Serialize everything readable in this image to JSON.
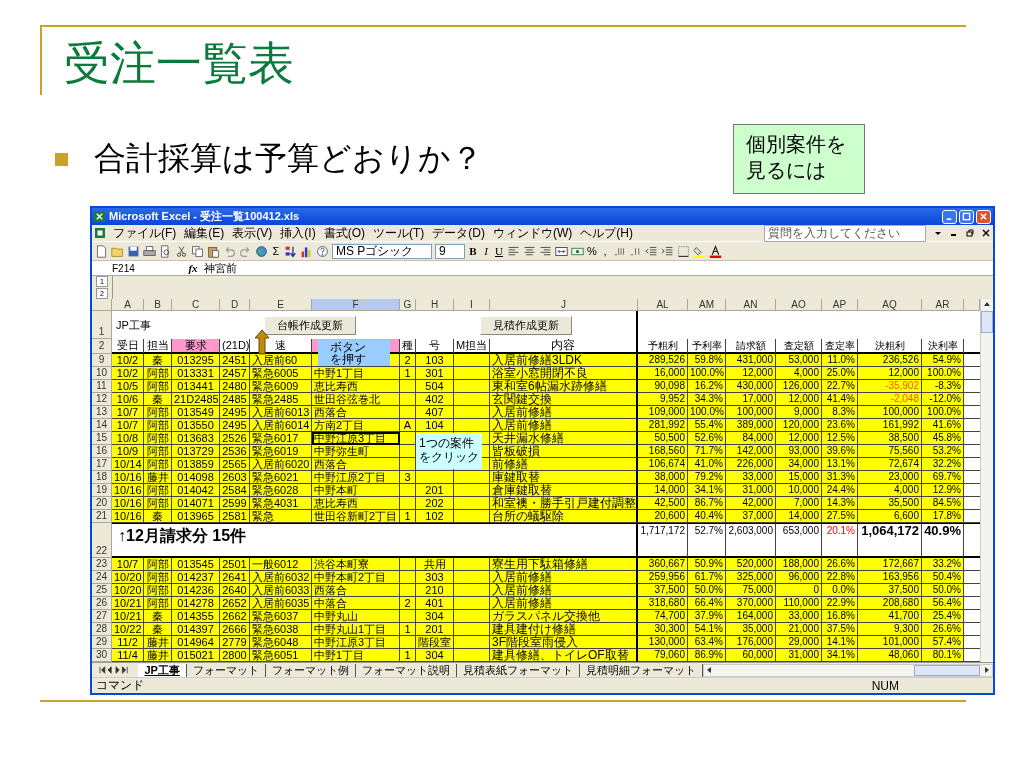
{
  "slide": {
    "title": "受注一覧表",
    "bullet": "合計採算は予算どおりか？",
    "note": "個別案件を見るには"
  },
  "window": {
    "title": "Microsoft Excel - 受注一覧100412.xls"
  },
  "menu": [
    "ファイル(F)",
    "編集(E)",
    "表示(V)",
    "挿入(I)",
    "書式(O)",
    "ツール(T)",
    "データ(D)",
    "ウィンドウ(W)",
    "ヘルプ(H)"
  ],
  "help_box": {
    "placeholder": "質問を入力してください"
  },
  "toolbar": {
    "sum": "Σ",
    "font": "MS Pゴシック",
    "size": "9",
    "format_buttons": [
      "B",
      "I",
      "U"
    ],
    "number_buttons": [
      "%",
      ","
    ]
  },
  "formula_bar": {
    "name_box": "F214",
    "fx": "fx",
    "value": "神宮前"
  },
  "outline_levels": [
    "1",
    "2"
  ],
  "columns": [
    {
      "label": "A",
      "selected": false
    },
    {
      "label": "B",
      "selected": false
    },
    {
      "label": "C",
      "selected": false
    },
    {
      "label": "D",
      "selected": false
    },
    {
      "label": "E",
      "selected": false
    },
    {
      "label": "F",
      "selected": true
    },
    {
      "label": "G",
      "selected": false
    },
    {
      "label": "H",
      "selected": false
    },
    {
      "label": "I",
      "selected": false
    },
    {
      "label": "J",
      "selected": false
    },
    {
      "label": "AL",
      "selected": false
    },
    {
      "label": "AM",
      "selected": false
    },
    {
      "label": "AN",
      "selected": false
    },
    {
      "label": "AO",
      "selected": false
    },
    {
      "label": "AP",
      "selected": false
    },
    {
      "label": "AQ",
      "selected": false
    },
    {
      "label": "AR",
      "selected": false
    }
  ],
  "row1": {
    "row": "1",
    "label": "JP工事",
    "buttons": [
      "台帳作成更新",
      "見積作成更新"
    ]
  },
  "header": {
    "row": "2",
    "cells": [
      {
        "text": "受日",
        "highlighted": false
      },
      {
        "text": "担当",
        "highlighted": false
      },
      {
        "text": "要求",
        "highlighted": true
      },
      {
        "text": "(21D)",
        "highlighted": false
      },
      {
        "text": "速",
        "highlighted": false
      },
      {
        "text": null,
        "highlighted": true
      },
      {
        "text": "種",
        "highlighted": false
      },
      {
        "text": "号",
        "highlighted": false
      },
      {
        "text": "M担当",
        "highlighted": false
      },
      {
        "text": "内容",
        "highlighted": false
      },
      {
        "text": "予粗利",
        "highlighted": false
      },
      {
        "text": "予利率",
        "highlighted": false
      },
      {
        "text": "請求額",
        "highlighted": false
      },
      {
        "text": "査定額",
        "highlighted": false
      },
      {
        "text": "査定率",
        "highlighted": false
      },
      {
        "text": "決粗利",
        "highlighted": false
      },
      {
        "text": "決利率",
        "highlighted": false
      }
    ]
  },
  "rows": [
    {
      "kind": "data",
      "row": "9",
      "cells": [
        "10/2",
        "秦",
        "013295",
        "2451",
        "入居前60",
        null,
        "2",
        "103",
        null,
        "入居前修繕3LDK",
        "289,526",
        "59.8%",
        "431,000",
        "53,000",
        "11.0%",
        "236,526",
        "54.9%"
      ]
    },
    {
      "kind": "data",
      "row": "10",
      "cells": [
        "10/2",
        "阿部",
        "013331",
        "2457",
        "緊急6005",
        "中野1丁目",
        "1",
        "301",
        null,
        "浴室小窓開閉不良",
        "16,000",
        "100.0%",
        "12,000",
        "4,000",
        "25.0%",
        "12,000",
        "100.0%"
      ]
    },
    {
      "kind": "data",
      "row": "11",
      "cells": [
        "10/5",
        "阿部",
        "013441",
        "2480",
        "緊急6009",
        "恵比寿西",
        null,
        "504",
        null,
        "東和室6帖漏水跡修繕",
        "90,098",
        "16.2%",
        "430,000",
        "126,000",
        "22.7%",
        {
          "text": "-35,902",
          "warn": true
        },
        "-8.3%"
      ]
    },
    {
      "kind": "data",
      "row": "12",
      "cells": [
        "10/6",
        "秦",
        "21D2485",
        "2485",
        "緊急2485",
        "世田谷弦巻北",
        null,
        "402",
        null,
        "玄関鍵交換",
        "9,952",
        "34.3%",
        "17,000",
        "12,000",
        "41.4%",
        {
          "text": "-2,048",
          "warn": true
        },
        "-12.0%"
      ]
    },
    {
      "kind": "data",
      "row": "13",
      "cells": [
        "10/7",
        "阿部",
        "013549",
        "2495",
        "入居前6013",
        "西落合",
        null,
        "407",
        null,
        "入居前修繕",
        "109,000",
        "100.0%",
        "100,000",
        "9,000",
        "8.3%",
        "100,000",
        "100.0%"
      ]
    },
    {
      "kind": "data",
      "row": "14",
      "cells": [
        "10/7",
        "阿部",
        "013550",
        "2495",
        "入居前6014",
        "方南2丁目",
        "A",
        "104",
        null,
        "入居前修繕",
        "281,992",
        "55.4%",
        "389,000",
        "120,000",
        "23.6%",
        "161,992",
        "41.6%"
      ]
    },
    {
      "kind": "data",
      "row": "15",
      "cells": [
        "10/8",
        "阿部",
        "013683",
        "2526",
        "緊急6017",
        {
          "text": "中野江原3丁目",
          "active": true
        },
        null,
        null,
        null,
        "天井漏水修繕",
        "50,500",
        "52.6%",
        "84,000",
        "12,000",
        "12.5%",
        "38,500",
        "45.8%"
      ]
    },
    {
      "kind": "data",
      "row": "16",
      "cells": [
        "10/9",
        "阿部",
        "013729",
        "2536",
        "緊急6019",
        "中野弥生町",
        null,
        null,
        null,
        "皆板破損",
        "168,560",
        "71.7%",
        "142,000",
        "93,000",
        "39.6%",
        "75,560",
        "53.2%"
      ]
    },
    {
      "kind": "data",
      "row": "17",
      "cells": [
        "10/14",
        "阿部",
        "013859",
        "2565",
        "入居前6020",
        "西落合",
        null,
        null,
        null,
        "前修繕",
        "106,674",
        "41.0%",
        "226,000",
        "34,000",
        "13.1%",
        "72,674",
        "32.2%"
      ]
    },
    {
      "kind": "data",
      "row": "18",
      "cells": [
        "10/16",
        "藤井",
        "014098",
        "2603",
        "緊急6021",
        "中野江原2丁目",
        "3",
        null,
        null,
        "庫鍵取替",
        "38,000",
        "79.2%",
        "33,000",
        "15,000",
        "31.3%",
        "23,000",
        "69.7%"
      ]
    },
    {
      "kind": "data",
      "row": "19",
      "cells": [
        "10/16",
        "阿部",
        "014042",
        "2584",
        "緊急6028",
        "中野本町",
        null,
        "201",
        null,
        "倉庫鍵取替",
        "14,000",
        "34.1%",
        "31,000",
        "10,000",
        "24.4%",
        "4,000",
        "12.9%"
      ]
    },
    {
      "kind": "data",
      "row": "20",
      "cells": [
        "10/16",
        "阿部",
        "014071",
        "2599",
        "緊急4031",
        "恵比寿西",
        null,
        "202",
        null,
        "和室襖・勝手引戸建付調整",
        "42,500",
        "86.7%",
        "42,000",
        "7,000",
        "14.3%",
        "35,500",
        "84.5%"
      ]
    },
    {
      "kind": "data",
      "row": "21",
      "cells": [
        "10/16",
        "秦",
        "013965",
        "2581",
        "緊急",
        "世田谷新町2丁目",
        "1",
        "102",
        null,
        "台所の蟻駆除",
        "20,600",
        "40.4%",
        "37,000",
        "14,000",
        "27.5%",
        "6,600",
        "17.8%"
      ]
    },
    {
      "kind": "total",
      "row": "22",
      "label": "↑12月請求分 15件",
      "cells": [
        "1,717,172",
        "52.7%",
        "2,603,000",
        "653,000",
        {
          "text": "20.1%",
          "warn": true
        },
        {
          "text": "1,064,172",
          "bold": true
        },
        {
          "text": "40.9%",
          "bold": true
        }
      ]
    },
    {
      "kind": "data",
      "row": "23",
      "cells": [
        "10/7",
        "阿部",
        "013545",
        "2501",
        "一般6012",
        "渋谷本町寮",
        null,
        "共用",
        null,
        "寮生用下駄箱修繕",
        "360,667",
        "50.9%",
        "520,000",
        "188,000",
        "26.6%",
        "172,667",
        "33.2%"
      ]
    },
    {
      "kind": "data",
      "row": "24",
      "cells": [
        "10/20",
        "阿部",
        "014237",
        "2641",
        "入居前6032",
        "中野本町2丁目",
        null,
        "303",
        null,
        "入居前修繕",
        "259,956",
        "61.7%",
        "325,000",
        "96,000",
        "22.8%",
        "163,956",
        "50.4%"
      ]
    },
    {
      "kind": "data",
      "row": "25",
      "cells": [
        "10/20",
        "阿部",
        "014236",
        "2640",
        "入居前6033",
        "西落合",
        null,
        "210",
        null,
        "入居前修繕",
        "37,500",
        "50.0%",
        "75,000",
        "0",
        "0.0%",
        "37,500",
        "50.0%"
      ]
    },
    {
      "kind": "data",
      "row": "26",
      "cells": [
        "10/21",
        "阿部",
        "014278",
        "2652",
        "入居前6035",
        "中落合",
        "2",
        "401",
        null,
        "入居前修繕",
        "318,680",
        "66.4%",
        "370,000",
        "110,000",
        "22.9%",
        "208,680",
        "56.4%"
      ]
    },
    {
      "kind": "data",
      "row": "27",
      "cells": [
        "10/21",
        "秦",
        "014355",
        "2662",
        "緊急6037",
        "中野丸山",
        null,
        "304",
        null,
        "ガラスパネル交換他",
        "74,700",
        "37.9%",
        "164,000",
        "33,000",
        "16.8%",
        "41,700",
        "25.4%"
      ]
    },
    {
      "kind": "data",
      "row": "28",
      "cells": [
        "10/22",
        "秦",
        "014397",
        "2666",
        "緊急6038",
        "中野丸山1丁目",
        "1",
        "201",
        null,
        "建具建付け修繕",
        "30,300",
        "54.1%",
        "35,000",
        "21,000",
        "37.5%",
        "9,300",
        "26.6%"
      ]
    },
    {
      "kind": "data",
      "row": "29",
      "cells": [
        "11/2",
        "藤井",
        "014964",
        "2779",
        "緊急6048",
        "中野江原3丁目",
        null,
        "階段室",
        null,
        "3F階段室雨侵入",
        "130,000",
        "63.4%",
        "176,000",
        "29,000",
        "14.1%",
        "101,000",
        "57.4%"
      ]
    },
    {
      "kind": "data",
      "row": "30",
      "cells": [
        "11/4",
        "藤井",
        "015021",
        "2800",
        "緊急6051",
        "中野1丁目",
        "1",
        "304",
        null,
        "建具修繕、トイレOF取替",
        "79,060",
        "86.9%",
        "60,000",
        "31,000",
        "34.1%",
        "48,060",
        "80.1%"
      ]
    }
  ],
  "callouts": [
    {
      "text": "ボタンを押す",
      "color": "#99ccff"
    },
    {
      "text": "1つの案件をクリック",
      "color": "#ccffff"
    }
  ],
  "sheet_tabs": [
    {
      "label": "JP工事",
      "selected": true
    },
    {
      "label": "フォーマット",
      "selected": false
    },
    {
      "label": "フォーマット例",
      "selected": false
    },
    {
      "label": "フォーマット説明",
      "selected": false
    },
    {
      "label": "見積表紙フォーマット",
      "selected": false
    },
    {
      "label": "見積明細フォーマット",
      "selected": false
    }
  ],
  "status_bar": {
    "mode": "コマンド",
    "num": "NUM"
  }
}
